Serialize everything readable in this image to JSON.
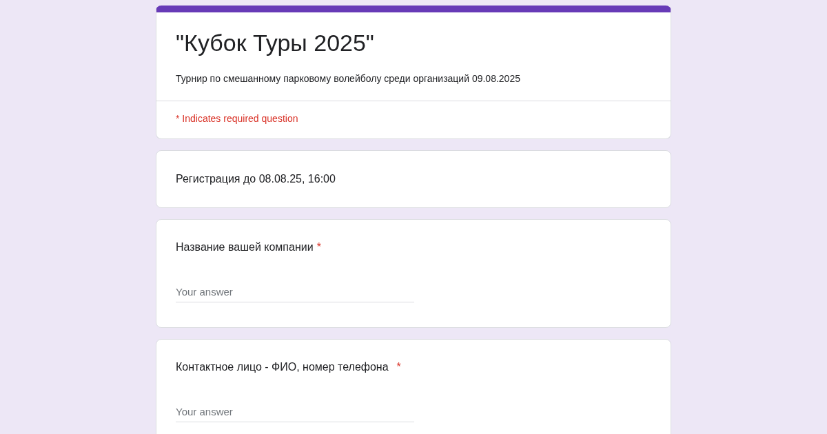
{
  "form": {
    "title": "\"Кубок Туры 2025\"",
    "description": "Турнир по смешанному парковому волейболу среди организаций 09.08.2025",
    "required_note": "* Indicates required question"
  },
  "sections": [
    {
      "kind": "text",
      "text": "Регистрация до 08.08.25, 16:00"
    },
    {
      "kind": "question",
      "title": "Название вашей компании",
      "required_mark": "*",
      "placeholder": "Your answer"
    },
    {
      "kind": "question",
      "title": "Контактное лицо - ФИО, номер телефона",
      "required_mark": "*",
      "placeholder": "Your answer"
    }
  ]
}
